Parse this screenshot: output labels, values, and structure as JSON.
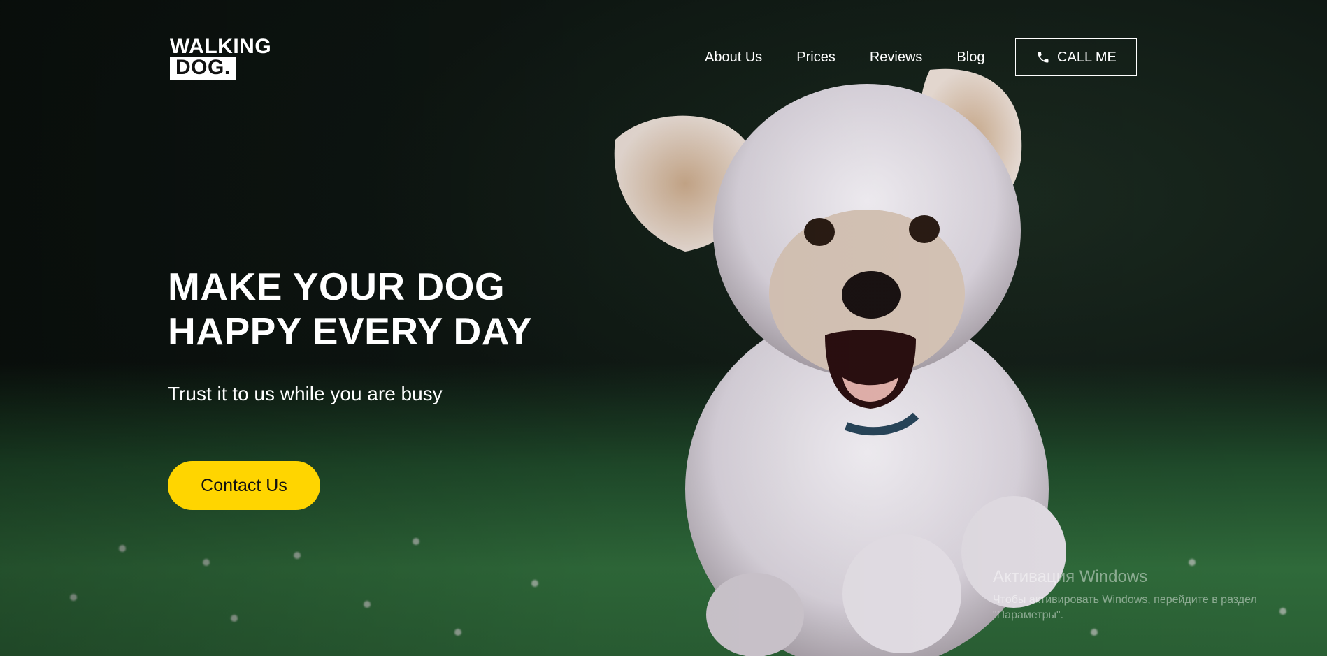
{
  "logo": {
    "line1": "WALKING",
    "line2": "DOG."
  },
  "nav": {
    "items": [
      "About Us",
      "Prices",
      "Reviews",
      "Blog"
    ],
    "call_label": "CALL ME"
  },
  "hero": {
    "headline_line1": "MAKE YOUR DOG",
    "headline_line2": "HAPPY EVERY DAY",
    "subheadline": "Trust it to us while you are busy",
    "cta_label": "Contact Us"
  },
  "watermark": {
    "title": "Активация Windows",
    "body": "Чтобы активировать Windows, перейдите в раздел \"Параметры\"."
  },
  "colors": {
    "accent": "#ffd500",
    "text": "#ffffff",
    "background": "#0e1612",
    "grass": "#2f6a3a"
  },
  "icons": {
    "call": "phone-icon"
  }
}
